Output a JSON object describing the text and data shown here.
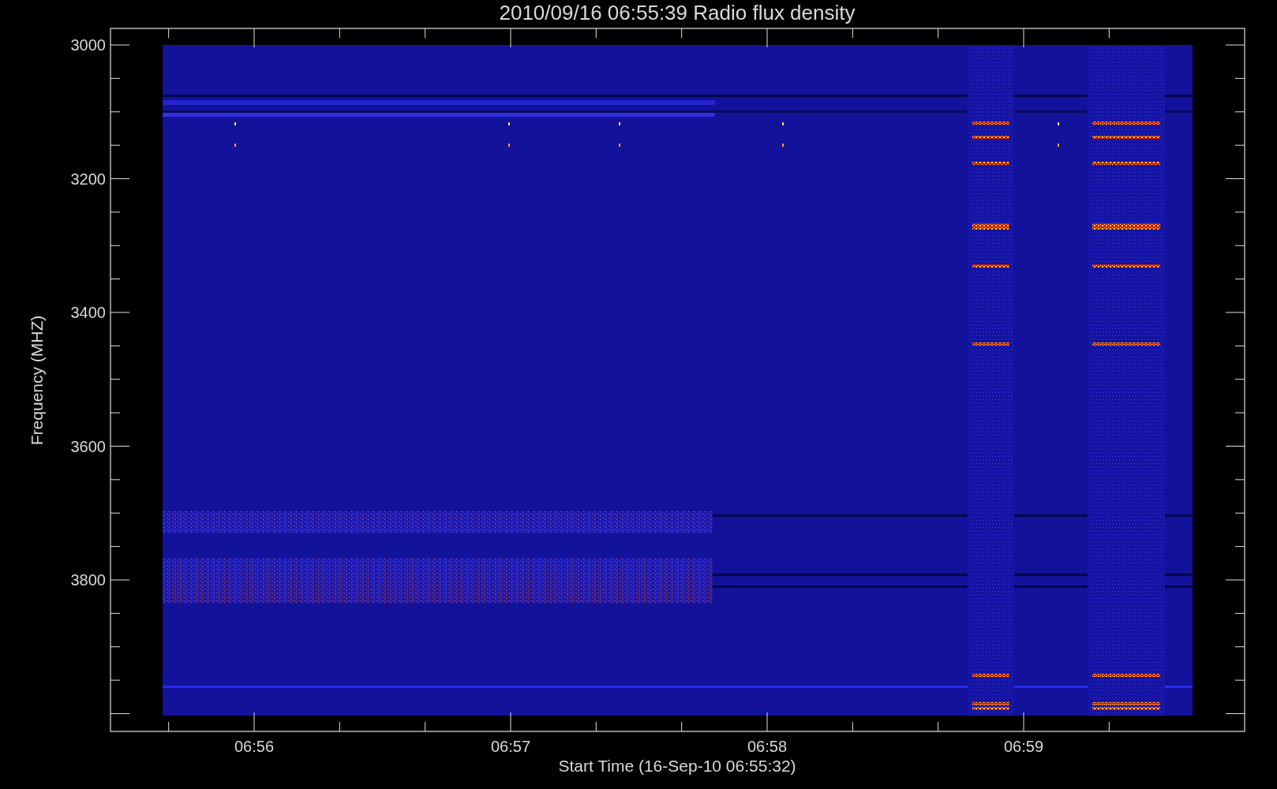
{
  "title": "2010/09/16 06:55:39 Radio flux density",
  "ylabel": "Frequency (MHZ)",
  "xlabel": "Start Time (16-Sep-10 06:55:32)",
  "yticks": [
    "3000",
    "3200",
    "3400",
    "3600",
    "3800"
  ],
  "xticks": [
    "06:56",
    "06:57",
    "06:58",
    "06:59"
  ]
}
